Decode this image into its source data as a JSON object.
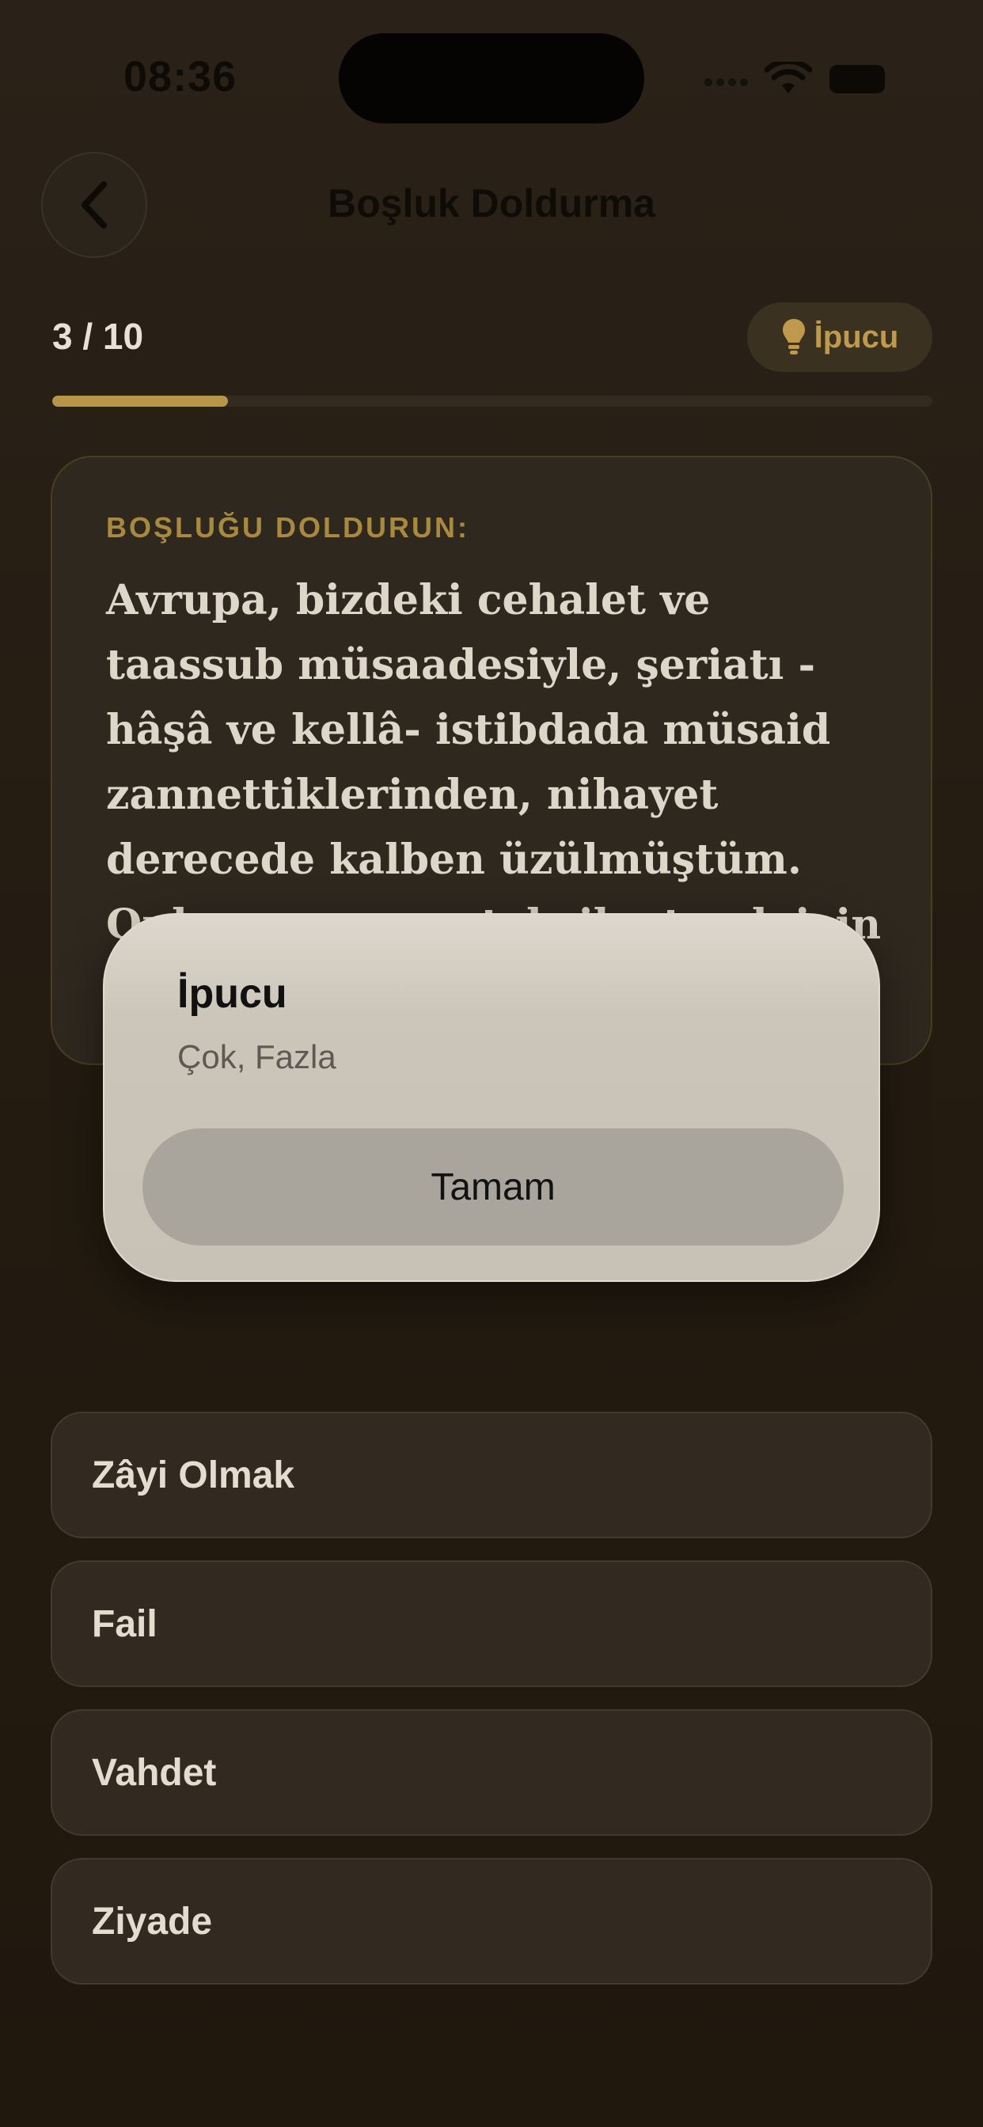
{
  "status_bar": {
    "time": "08:36"
  },
  "header": {
    "title": "Boşluk Doldurma"
  },
  "progress": {
    "label": "3 / 10",
    "current": 3,
    "total": 10,
    "fraction": 0.2
  },
  "hint_button": {
    "label": "İpucu"
  },
  "question": {
    "heading": "BOŞLUĞU DOLDURUN:",
    "text": "Avrupa, bizdeki cehalet ve taassub müsaadesiyle, şeriatı -hâşâ ve kellâ- istibdada müsaid zannettiklerinden, nihayet derecede kalben üzülmüştüm. Onların zannını tekzib etmek için ..."
  },
  "alert": {
    "title": "İpucu",
    "message": "Çok, Fazla",
    "button_label": "Tamam"
  },
  "options": [
    {
      "label": "Zâyi Olmak"
    },
    {
      "label": "Fail"
    },
    {
      "label": "Vahdet"
    },
    {
      "label": "Ziyade"
    }
  ],
  "colors": {
    "accent": "#b99549",
    "background": "#231b10",
    "card": "#2f281f"
  },
  "icons": {
    "back": "chevron-left-icon",
    "hint": "lightbulb-icon",
    "wifi": "wifi-icon",
    "battery": "battery-icon"
  }
}
